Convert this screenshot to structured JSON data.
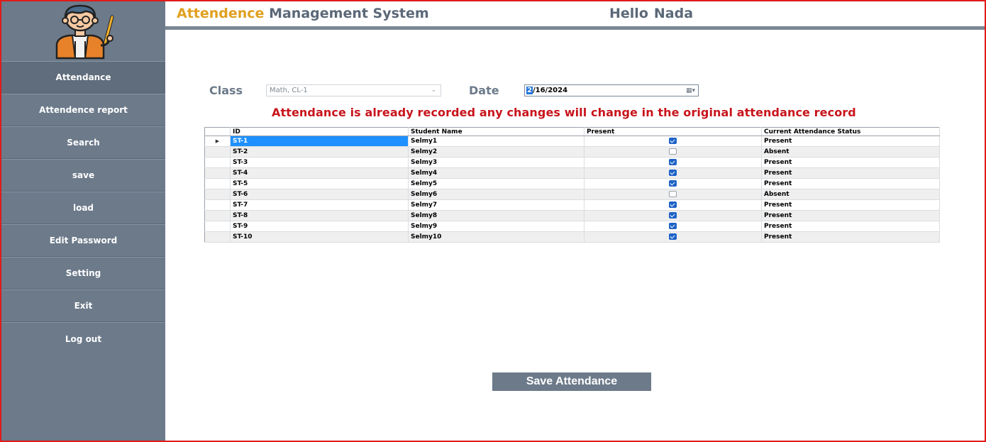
{
  "header": {
    "title_part1": "Attendence",
    "title_part2": "Management System",
    "greeting": "Hello",
    "user_name": "Nada"
  },
  "sidebar": {
    "items": [
      {
        "label": "Attendance",
        "active": true
      },
      {
        "label": "Attendence report"
      },
      {
        "label": "Search"
      },
      {
        "label": "save"
      },
      {
        "label": "load"
      },
      {
        "label": "Edit Password"
      },
      {
        "label": "Setting"
      },
      {
        "label": "Exit"
      },
      {
        "label": "Log out"
      }
    ]
  },
  "form": {
    "class_label": "Class",
    "class_value": "Math, CL-1",
    "date_label": "Date",
    "date_value_selected": "2",
    "date_value_rest": "/16/2024"
  },
  "warning": "Attendance is already recorded any changes will change in the original attendance record",
  "table": {
    "columns": [
      "ID",
      "Student Name",
      "Present",
      "Current Attendance Status"
    ],
    "rows": [
      {
        "id": "ST-1",
        "name": "Selmy1",
        "present": true,
        "status": "Present"
      },
      {
        "id": "ST-2",
        "name": "Selmy2",
        "present": false,
        "status": "Absent"
      },
      {
        "id": "ST-3",
        "name": "Selmy3",
        "present": true,
        "status": "Present"
      },
      {
        "id": "ST-4",
        "name": "Selmy4",
        "present": true,
        "status": "Present"
      },
      {
        "id": "ST-5",
        "name": "Selmy5",
        "present": true,
        "status": "Present"
      },
      {
        "id": "ST-6",
        "name": "Selmy6",
        "present": false,
        "status": "Absent"
      },
      {
        "id": "ST-7",
        "name": "Selmy7",
        "present": true,
        "status": "Present"
      },
      {
        "id": "ST-8",
        "name": "Selmy8",
        "present": true,
        "status": "Present"
      },
      {
        "id": "ST-9",
        "name": "Selmy9",
        "present": true,
        "status": "Present"
      },
      {
        "id": "ST-10",
        "name": "Selmy10",
        "present": true,
        "status": "Present"
      }
    ]
  },
  "save_button": "Save Attendance",
  "colors": {
    "frame_border": "#e01b1b",
    "sidebar_bg": "#6c7a8a",
    "title_accent": "#e0a020",
    "warning_text": "#c8141c",
    "selection_blue": "#1e90ff"
  },
  "icons": {
    "logo": "teacher-with-pointer-icon"
  }
}
